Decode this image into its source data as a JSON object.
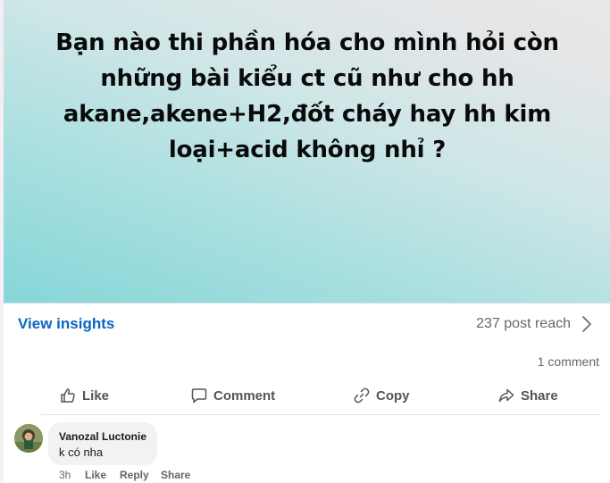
{
  "post": {
    "text": "Bạn nào thi phần hóa cho mình hỏi còn những bài kiểu ct cũ như cho hh akane,akene+H2,đốt cháy hay hh kim loại+acid không nhỉ ?"
  },
  "insights": {
    "label": "View insights",
    "reach": "237 post reach"
  },
  "stats": {
    "comments": "1 comment"
  },
  "actions": {
    "like": "Like",
    "comment": "Comment",
    "copy": "Copy",
    "share": "Share"
  },
  "comment": {
    "author": "Vanozal Luctonie",
    "text": "k có nha",
    "time": "3h",
    "like": "Like",
    "reply": "Reply",
    "share": "Share"
  },
  "colors": {
    "accent": "#0a66c2",
    "muted_text": "#666666"
  },
  "icons": [
    "like-icon",
    "comment-icon",
    "copy-icon",
    "share-icon",
    "chevron-right-icon"
  ]
}
